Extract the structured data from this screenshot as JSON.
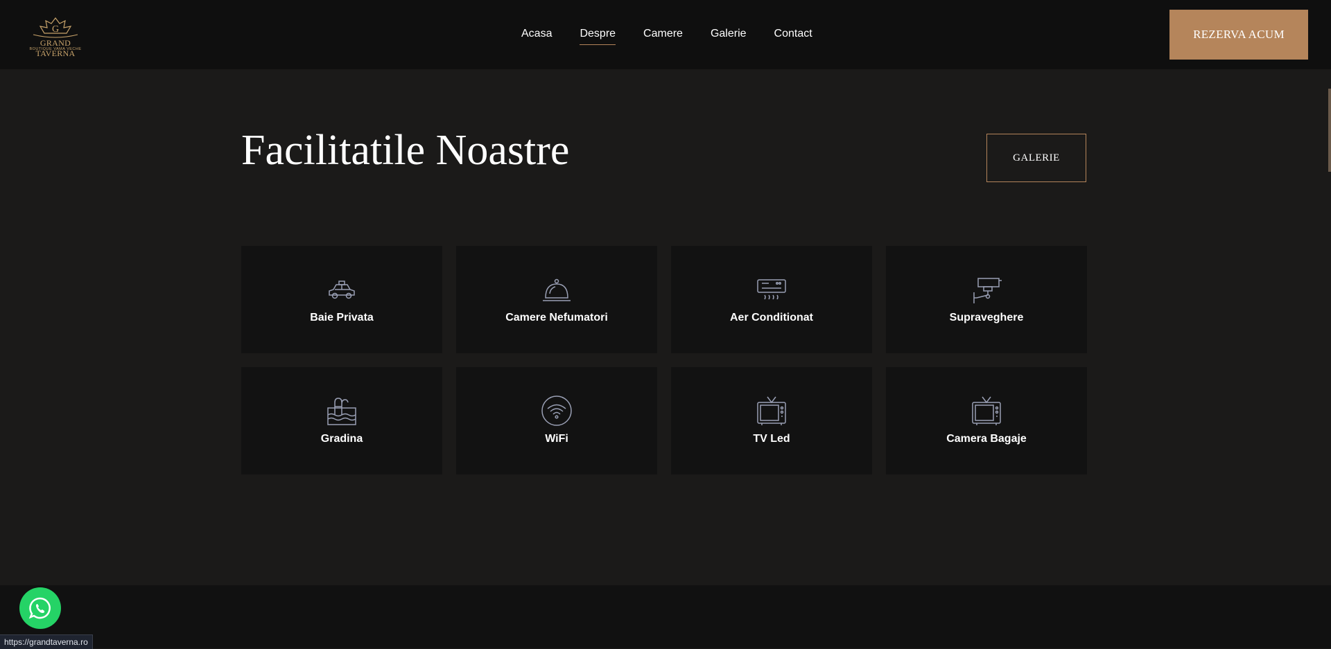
{
  "header": {
    "logo_text": "GRAND TAVERNA",
    "logo_sub": "BOUTIQUE VAMA VECHE",
    "nav": [
      {
        "label": "Acasa"
      },
      {
        "label": "Despre"
      },
      {
        "label": "Camere"
      },
      {
        "label": "Galerie"
      },
      {
        "label": "Contact"
      }
    ],
    "active_nav": "Despre",
    "cta_label": "REZERVA ACUM"
  },
  "section": {
    "title": "Facilitatile Noastre",
    "gallery_button": "GALERIE"
  },
  "facilities": [
    {
      "label": "Baie Privata",
      "icon": "taxi-icon"
    },
    {
      "label": "Camere Nefumatori",
      "icon": "room-service-bell-icon"
    },
    {
      "label": "Aer Conditionat",
      "icon": "air-conditioner-icon"
    },
    {
      "label": "Supraveghere",
      "icon": "security-camera-icon"
    },
    {
      "label": "Gradina",
      "icon": "pool-icon"
    },
    {
      "label": "WiFi",
      "icon": "wifi-icon"
    },
    {
      "label": "TV Led",
      "icon": "tv-icon"
    },
    {
      "label": "Camera Bagaje",
      "icon": "tv-icon"
    }
  ],
  "status_bar": {
    "url": "https://grandtaverna.ro"
  },
  "colors": {
    "accent": "#b5855b",
    "icon_stroke": "#9aa0b5",
    "whatsapp": "#25d366"
  }
}
